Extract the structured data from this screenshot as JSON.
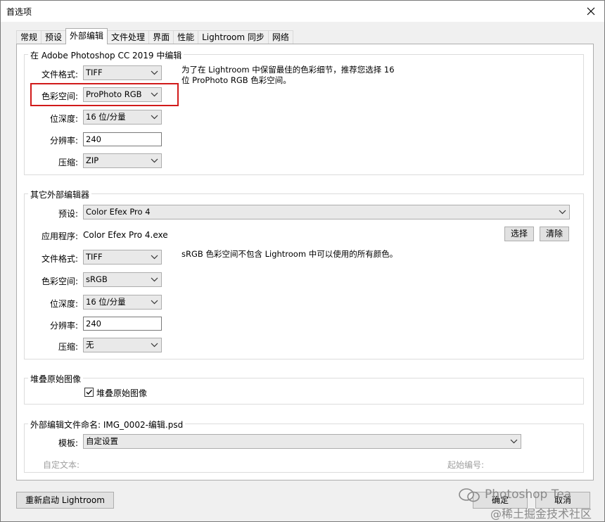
{
  "window": {
    "title": "首选项"
  },
  "tabs": [
    "常规",
    "预设",
    "外部编辑",
    "文件处理",
    "界面",
    "性能",
    "Lightroom 同步",
    "网络"
  ],
  "photoshop": {
    "group_title": "在 Adobe Photoshop CC 2019 中编辑",
    "file_format_label": "文件格式:",
    "file_format": "TIFF",
    "color_space_label": "色彩空间:",
    "color_space": "ProPhoto RGB",
    "bit_depth_label": "位深度:",
    "bit_depth": "16 位/分量",
    "resolution_label": "分辨率:",
    "resolution": "240",
    "compression_label": "压缩:",
    "compression": "ZIP",
    "note_line1": "为了在 Lightroom 中保留最佳的色彩细节，推荐您选择 16",
    "note_line2": "位 ProPhoto RGB 色彩空间。"
  },
  "other": {
    "group_title": "其它外部编辑器",
    "preset_label": "预设:",
    "preset": "Color Efex Pro 4",
    "app_label": "应用程序:",
    "app": "Color Efex Pro 4.exe",
    "choose_button": "选择",
    "clear_button": "清除",
    "file_format_label": "文件格式:",
    "file_format": "TIFF",
    "color_space_label": "色彩空间:",
    "color_space": "sRGB",
    "bit_depth_label": "位深度:",
    "bit_depth": "16 位/分量",
    "resolution_label": "分辨率:",
    "resolution": "240",
    "compression_label": "压缩:",
    "compression": "无",
    "note": "sRGB 色彩空间不包含 Lightroom 中可以使用的所有颜色。"
  },
  "stack": {
    "group_title": "堆叠原始图像",
    "checkbox_label": "堆叠原始图像",
    "checked": true
  },
  "naming": {
    "group_title": "外部编辑文件命名: IMG_0002-编辑.psd",
    "template_label": "模板:",
    "template": "自定设置",
    "custom_text_label": "自定文本:",
    "start_number_label": "起始编号:"
  },
  "footer": {
    "restart_button": "重新启动 Lightroom",
    "ok_button": "确定",
    "cancel_button": "取消"
  },
  "watermark": {
    "line1": "Photoshop Tea",
    "line2": "@稀土掘金技术社区"
  },
  "colors": {
    "highlight": "#d11a1a"
  },
  "icons": [
    "close-icon",
    "chevron-down-icon",
    "check-icon",
    "wechat-icon"
  ]
}
